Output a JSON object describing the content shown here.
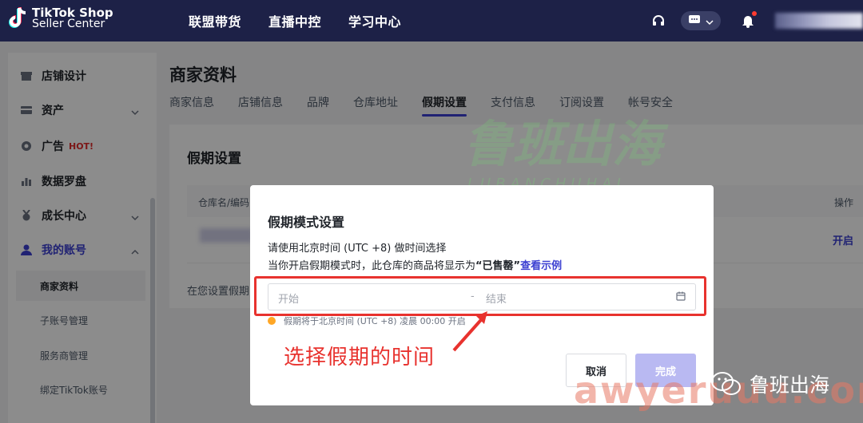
{
  "topbar": {
    "logo_line1": "TikTok Shop",
    "logo_line2": "Seller Center",
    "nav": [
      "联盟带货",
      "直播中控",
      "学习中心"
    ],
    "icons": [
      "headset-icon",
      "message-icon",
      "chevron-down-icon",
      "bell-icon"
    ]
  },
  "sidebar": {
    "items": [
      {
        "label": "店铺设计",
        "icon": "shop-icon"
      },
      {
        "label": "资产",
        "icon": "card-icon"
      },
      {
        "label": "广告",
        "icon": "ad-icon",
        "badge": "HOT!"
      },
      {
        "label": "数据罗盘",
        "icon": "chart-icon"
      },
      {
        "label": "成长中心",
        "icon": "medal-icon"
      },
      {
        "label": "我的账号",
        "icon": "user-icon"
      }
    ],
    "sub_items": [
      "商家资料",
      "子账号管理",
      "服务商管理",
      "绑定TikTok账号"
    ]
  },
  "main": {
    "title": "商家资料",
    "tabs": [
      "商家信息",
      "店铺信息",
      "品牌",
      "仓库地址",
      "假期设置",
      "支付信息",
      "订阅设置",
      "帐号安全"
    ],
    "section_title": "假期设置",
    "table_header_col1": "仓库名/编码",
    "table_header_op": "操作",
    "row_action": "开启",
    "note": "在您设置假期"
  },
  "modal": {
    "title": "假期模式设置",
    "line1": "请使用北京时间 (UTC +8) 做时间选择",
    "line2_prefix": "当你开启假期模式时，此仓库的商品将显示为",
    "line2_status": "“已售罄”",
    "line2_link": "查看示例",
    "start_placeholder": "开始",
    "separator": "-",
    "end_placeholder": "结束",
    "hint": "假期将于北京时间 (UTC +8) 凌晨 00:00 开启",
    "cancel": "取消",
    "done": "完成"
  },
  "annotation": {
    "text": "选择假期的时间",
    "color": "#e8322e"
  },
  "watermark": {
    "big": "鲁班出海",
    "small": "LUBANCHUHAI",
    "awg": "awyeruuu.com"
  },
  "brand": {
    "name": "鲁班出海"
  },
  "colors": {
    "nav_bg": "#1d2147",
    "accent": "#3b3fd1",
    "hot": "#e22a2a"
  }
}
